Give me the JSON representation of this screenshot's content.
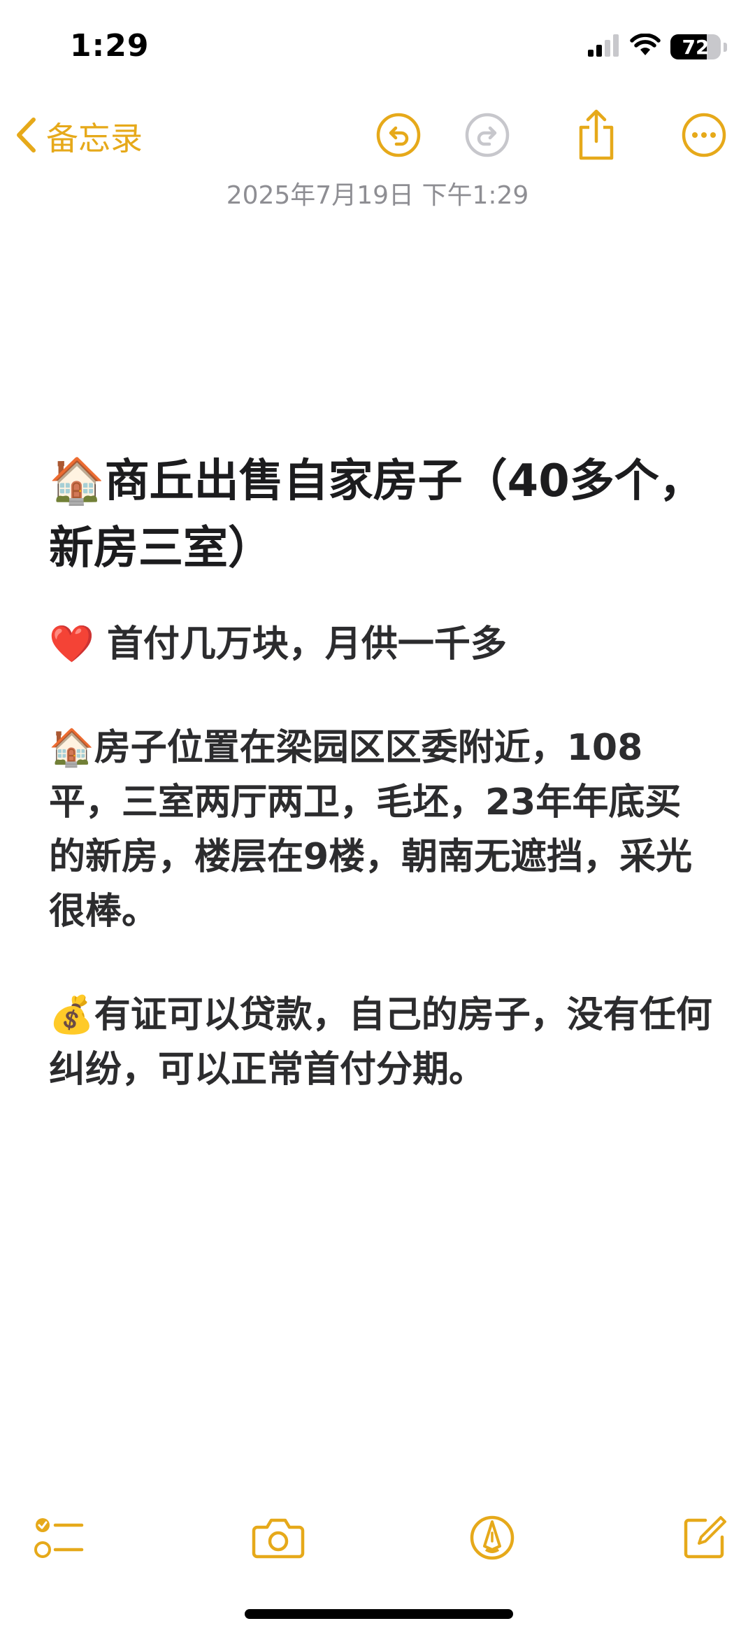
{
  "status_bar": {
    "time": "1:29",
    "battery_level": 72,
    "battery_text": "72"
  },
  "nav": {
    "back_label": "备忘录",
    "icons": {
      "back": "chevron-left-icon",
      "undo": "undo-icon",
      "redo": "redo-icon",
      "share": "share-icon",
      "more": "ellipsis-circle-icon"
    }
  },
  "note": {
    "date": "2025年7月19日 下午1:29",
    "title": "🏠商丘出售自家房子（40多个，新房三室）",
    "paragraphs": [
      "❤️ 首付几万块，月供一千多",
      "🏠房子位置在梁园区区委附近，108平，三室两厅两卫，毛坯，23年年底买的新房，楼层在9楼，朝南无遮挡，采光很棒。",
      "💰有证可以贷款，自己的房子，没有任何纠纷，可以正常首付分期。"
    ]
  },
  "toolbar": {
    "icons": {
      "checklist": "checklist-icon",
      "camera": "camera-icon",
      "markup": "markup-pen-icon",
      "compose": "compose-icon"
    }
  },
  "colors": {
    "accent": "#e6a91a",
    "disabled": "#c7c7cc",
    "date_text": "#8e8e93"
  }
}
